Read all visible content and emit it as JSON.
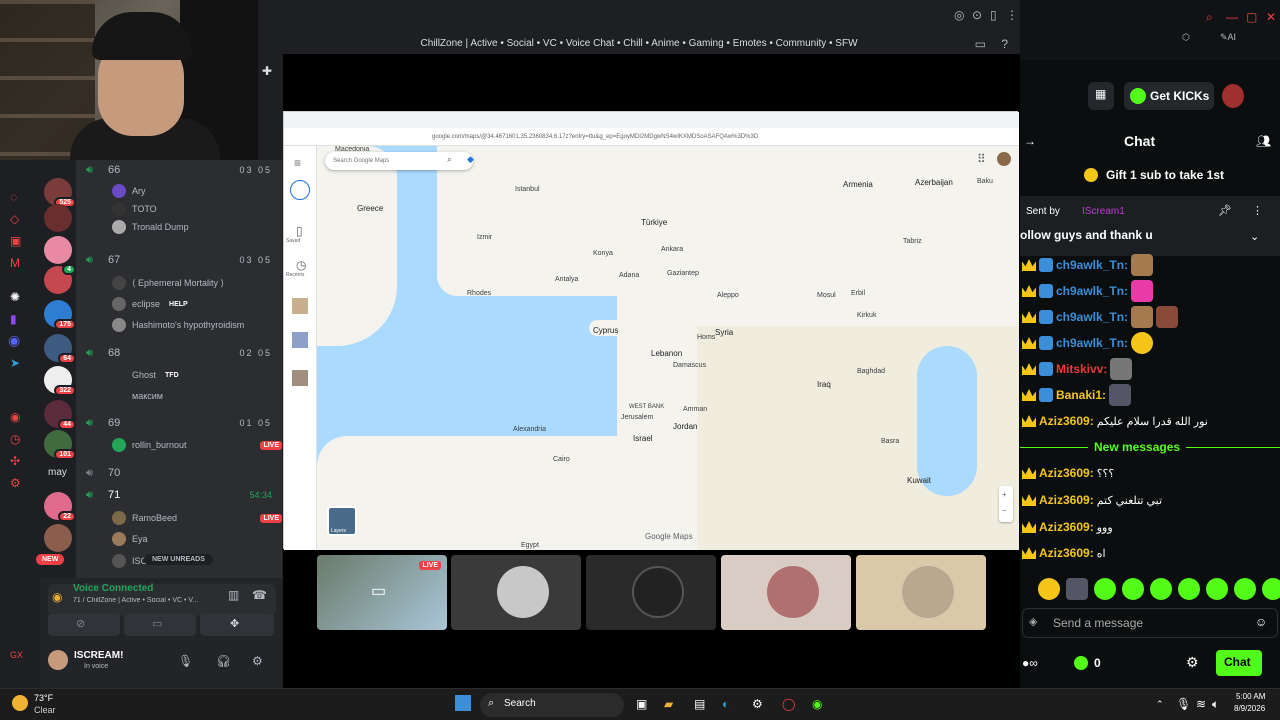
{
  "window": {
    "server_title": "ChillZone | Active • Social • VC • Voice Chat • Chill • Anime • Gaming • Emotes • Community • SFW"
  },
  "guilds": [
    {
      "badge": "525"
    },
    {
      "badge": ""
    },
    {
      "badge": ""
    },
    {
      "badge": "4"
    },
    {
      "badge": "175"
    },
    {
      "badge": "64"
    },
    {
      "badge": "322"
    },
    {
      "badge": "44"
    },
    {
      "badge": "101"
    },
    {
      "label": "may"
    },
    {
      "badge": "22"
    },
    {
      "badge": ""
    },
    {
      "label": "NEW"
    }
  ],
  "voice_channels": [
    {
      "name": "66",
      "count": "03 05",
      "users": [
        "Ary",
        "TOTO",
        "Tronald Dump"
      ]
    },
    {
      "name": "67",
      "count": "03 05",
      "users": [
        "⟨ Ephemeral Mortality ⟩",
        "eclipse",
        "Hashimoto's hypothyroidism"
      ]
    },
    {
      "name": "68",
      "count": "02 05",
      "users": [
        "Ghost",
        "максим"
      ]
    },
    {
      "name": "69",
      "count": "01 05",
      "users": [
        "rollin_burnout"
      ]
    },
    {
      "name": "70",
      "count": "",
      "users": []
    },
    {
      "name": "71",
      "count": "54:34",
      "users": [
        "RamoBeed",
        "Eya",
        "ISC"
      ]
    }
  ],
  "labels": {
    "help_tag": "HELP",
    "tfd_tag": "TFD",
    "live": "LIVE",
    "new_unreads": "NEW UNREADS",
    "voice_connected": "Voice Connected",
    "voice_sub": "71 / ChillZone | Active • Social • VC • V...",
    "username": "ISCREAM!",
    "user_status": "In voice"
  },
  "browser": {
    "url": "google.com/maps/@34.4671601,35.2360834,6.17z?entry=ttu&g_ep=EgoyMDI2MDgwNS4wIKXMDSoASAFQAw%3D%3D",
    "search_placeholder": "Search Google Maps",
    "side_items": [
      "Saved",
      "Recents"
    ]
  },
  "map_labels": {
    "countries": [
      "Greece",
      "Türkiye",
      "Armenia",
      "Azerbaijan",
      "Cyprus",
      "Syria",
      "Lebanon",
      "Iraq",
      "Jordan",
      "Israel",
      "Kuwait"
    ],
    "cities": [
      "Istanbul",
      "Ankara",
      "Konya",
      "Antalya",
      "Izmir",
      "Adana",
      "Gaziantep",
      "Damascus",
      "Baghdad",
      "Tabriz",
      "Mosul",
      "Erbil",
      "Aleppo",
      "Jerusalem",
      "Amman",
      "Cairo",
      "Alexandria",
      "Basra",
      "Homs",
      "Kirkuk",
      "Baku",
      "Rhodes",
      "Macedonia",
      "Egypt"
    ],
    "other": [
      "WEST BANK"
    ],
    "brand": "Google Maps",
    "layers": "Layers"
  },
  "tiles": [
    {
      "label": "LIVE",
      "color": "#4a4f57"
    },
    {
      "color": "#3a3a3a"
    },
    {
      "color": "#2a2a2a"
    },
    {
      "color": "#d8ccc4"
    },
    {
      "color": "#d9c9a8"
    }
  ],
  "kick": {
    "get_kicks": "Get KICKs",
    "chat_title": "Chat",
    "gift": "Gift 1 sub to take 1st",
    "pinned_sent_by": "Sent by",
    "pinned_author": "IScream1",
    "pinned_text": "ollow guys and thank u",
    "new_messages": "New messages",
    "send_placeholder": "Send a message",
    "kicks_count": "0",
    "chat_button": "Chat",
    "messages": [
      {
        "user": "ch9awlk_Tn:",
        "color": "#3a8fd8",
        "text": ""
      },
      {
        "user": "ch9awlk_Tn:",
        "color": "#3a8fd8",
        "text": ""
      },
      {
        "user": "ch9awlk_Tn:",
        "color": "#3a8fd8",
        "text": ""
      },
      {
        "user": "ch9awlk_Tn:",
        "color": "#3a8fd8",
        "text": ""
      },
      {
        "user": "Mitskivv:",
        "color": "#e93a3a",
        "text": ""
      },
      {
        "user": "Banaki1:",
        "color": "#f5c518",
        "text": ""
      },
      {
        "user": "Aziz3609:",
        "color": "#f5c518",
        "text": "نور الله قدرا سلام عليكم"
      },
      {
        "user": "Aziz3609:",
        "color": "#f5c518",
        "text": "؟؟؟"
      },
      {
        "user": "Aziz3609:",
        "color": "#f5c518",
        "text": "تبي تتلعني كتم"
      },
      {
        "user": "Aziz3609:",
        "color": "#f5c518",
        "text": "ووو"
      },
      {
        "user": "Aziz3609:",
        "color": "#f5c518",
        "text": "اه"
      }
    ]
  },
  "taskbar": {
    "weather_temp": "73°F",
    "weather_desc": "Clear",
    "search": "Search",
    "time": "5:00 AM",
    "date": "8/9/2026"
  },
  "colors": {
    "kick_green": "#53fc18",
    "discord_green": "#23a55a",
    "live_red": "#ed4245"
  }
}
